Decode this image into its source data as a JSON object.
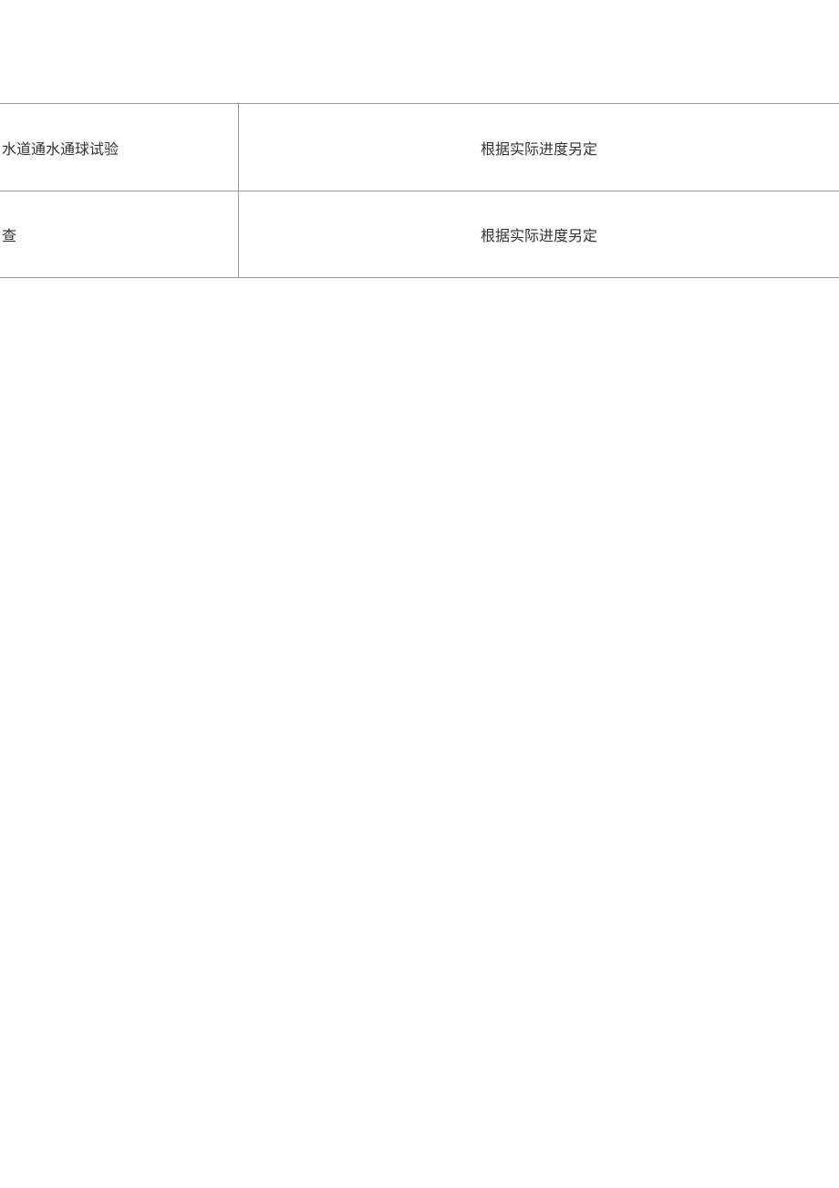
{
  "table": {
    "rows": [
      {
        "left": "水道通水通球试验",
        "right": "根据实际进度另定"
      },
      {
        "left": "查",
        "right": "根据实际进度另定"
      }
    ]
  }
}
